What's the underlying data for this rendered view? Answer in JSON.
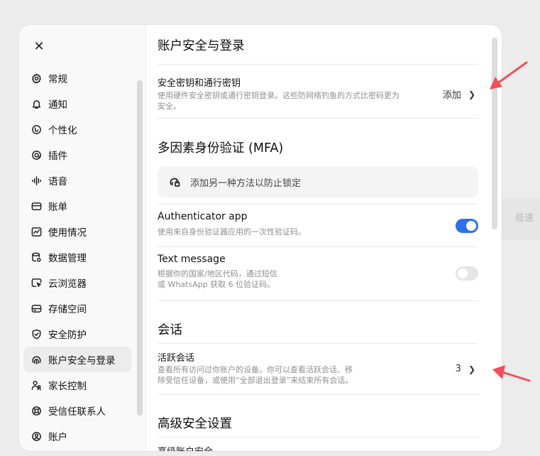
{
  "background": {
    "fast_label": "极速"
  },
  "sidebar": {
    "close_icon": "close-icon",
    "items": [
      {
        "label": "常规",
        "icon": "gear-icon"
      },
      {
        "label": "通知",
        "icon": "bell-icon"
      },
      {
        "label": "个性化",
        "icon": "personalize-icon"
      },
      {
        "label": "插件",
        "icon": "plugin-icon"
      },
      {
        "label": "语音",
        "icon": "waveform-icon"
      },
      {
        "label": "账单",
        "icon": "card-icon"
      },
      {
        "label": "使用情况",
        "icon": "chart-icon"
      },
      {
        "label": "数据管理",
        "icon": "database-icon"
      },
      {
        "label": "云浏览器",
        "icon": "browser-icon"
      },
      {
        "label": "存储空间",
        "icon": "storage-icon"
      },
      {
        "label": "安全防护",
        "icon": "shield-icon"
      },
      {
        "label": "账户安全与登录",
        "icon": "fingerprint-icon",
        "active": true
      },
      {
        "label": "家长控制",
        "icon": "family-icon"
      },
      {
        "label": "受信任联系人",
        "icon": "lifebuoy-icon"
      },
      {
        "label": "账户",
        "icon": "account-icon"
      }
    ]
  },
  "main": {
    "title": "账户安全与登录",
    "passkeys": {
      "title": "安全密钥和通行密钥",
      "desc_line1": "使用硬件安全密钥或通行密钥登录。这些防网络钓鱼的方式比密码更为",
      "desc_line2": "安全。",
      "action": "添加"
    },
    "mfa": {
      "title": "多因素身份验证 (MFA)",
      "add_method": "添加另一种方法以防止锁定",
      "authenticator": {
        "title": "Authenticator app",
        "desc": "使用来自身份验证器应用的一次性验证码。",
        "enabled": true
      },
      "text_message": {
        "title": "Text message",
        "desc_line1": "根据你的国家/地区代码，通过短信",
        "desc_line2": "或 WhatsApp 获取 6 位验证码。",
        "enabled": false
      }
    },
    "sessions": {
      "title": "会话",
      "active": {
        "title": "活跃会话",
        "desc_line1": "查看所有访问过你账户的设备。你可以查看活跃会话、移",
        "desc_line2": "除受信任设备，或使用“全部退出登录”来结束所有会话。",
        "count": "3"
      }
    },
    "advanced": {
      "title": "高级安全设置",
      "cut_item": "高级账户安全"
    }
  },
  "colors": {
    "accent": "#2f6fe8",
    "arrow": "#f0505a"
  }
}
